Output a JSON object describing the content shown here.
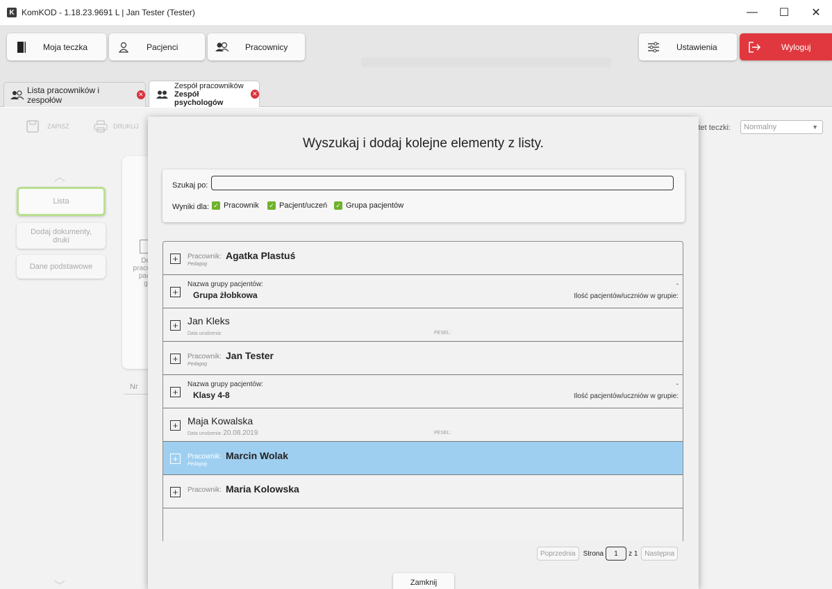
{
  "window": {
    "app_icon": "K",
    "title": "KomKOD - 1.18.23.9691 L | Jan Tester (Tester)",
    "minimize": "—",
    "maximize": "☐",
    "close": "✕"
  },
  "nav": {
    "my_folder": "Moja teczka",
    "patients": "Pacjenci",
    "employees": "Pracownicy",
    "settings": "Ustawienia",
    "logout": "Wyloguj"
  },
  "tabs": [
    {
      "label": "Lista pracowników i zespołów"
    },
    {
      "label_line1": "Zespół pracowników",
      "label_line2": "Zespół psychologów"
    }
  ],
  "background": {
    "save": "ZAPISZ",
    "print": "DRUKUJ",
    "side_items": [
      "Lista",
      "Dodaj dokumenty, druki",
      "Dane podstawowe"
    ],
    "fragment_lines": [
      "De",
      "pracc",
      "pac",
      "gr"
    ],
    "nr_label": "Nr",
    "priority_label": "ytet teczki:",
    "priority_value": "Normalny"
  },
  "modal": {
    "title": "Wyszukaj i dodaj kolejne elementy z listy.",
    "search_label": "Szukaj po:",
    "search_value": "",
    "results_for": "Wyniki dla:",
    "filters": [
      {
        "label": "Pracownik",
        "checked": true
      },
      {
        "label": "Pacjent/uczeń",
        "checked": true
      },
      {
        "label": "Grupa pacjentów",
        "checked": true
      }
    ],
    "results": [
      {
        "kind": "employee",
        "prefix": "Pracownik:",
        "name": "Agatka Plastuś",
        "role": "Pedagog",
        "selected": false
      },
      {
        "kind": "group",
        "label": "Nazwa grupy pacjentów:",
        "name": "Grupa żłobkowa",
        "count_label": "Ilość pacjentów/uczniów w grupie:",
        "count": "-",
        "selected": false
      },
      {
        "kind": "patient",
        "name": "Jan Kleks",
        "dob_label": "Data urodzenia:",
        "dob": "",
        "pesel_label": "PESEL:",
        "selected": false
      },
      {
        "kind": "employee",
        "prefix": "Pracownik:",
        "name": "Jan Tester",
        "role": "Pedagog",
        "selected": false
      },
      {
        "kind": "group",
        "label": "Nazwa grupy pacjentów:",
        "name": "Klasy 4-8",
        "count_label": "Ilość pacjentów/uczniów w grupie:",
        "count": "-",
        "selected": false
      },
      {
        "kind": "patient",
        "name": "Maja Kowalska",
        "dob_label": "Data urodzenia:",
        "dob": "20.08.2019",
        "pesel_label": "PESEL:",
        "selected": false
      },
      {
        "kind": "employee",
        "prefix": "Pracownik:",
        "name": "Marcin Wolak",
        "role": "Pedagog",
        "selected": true
      },
      {
        "kind": "employee",
        "prefix": "Pracownik:",
        "name": "Maria Kolowska",
        "role": "",
        "selected": false
      }
    ],
    "pager": {
      "prev": "Poprzednia",
      "page_label": "Strona",
      "page": "1",
      "of_label": "z 1",
      "next": "Następna"
    },
    "close": "Zamknij"
  },
  "colors": {
    "selected_row": "#9fcff0",
    "logout_red": "#e0383e",
    "checkbox_green": "#6fb22c",
    "active_side_border": "#b9e08f"
  }
}
